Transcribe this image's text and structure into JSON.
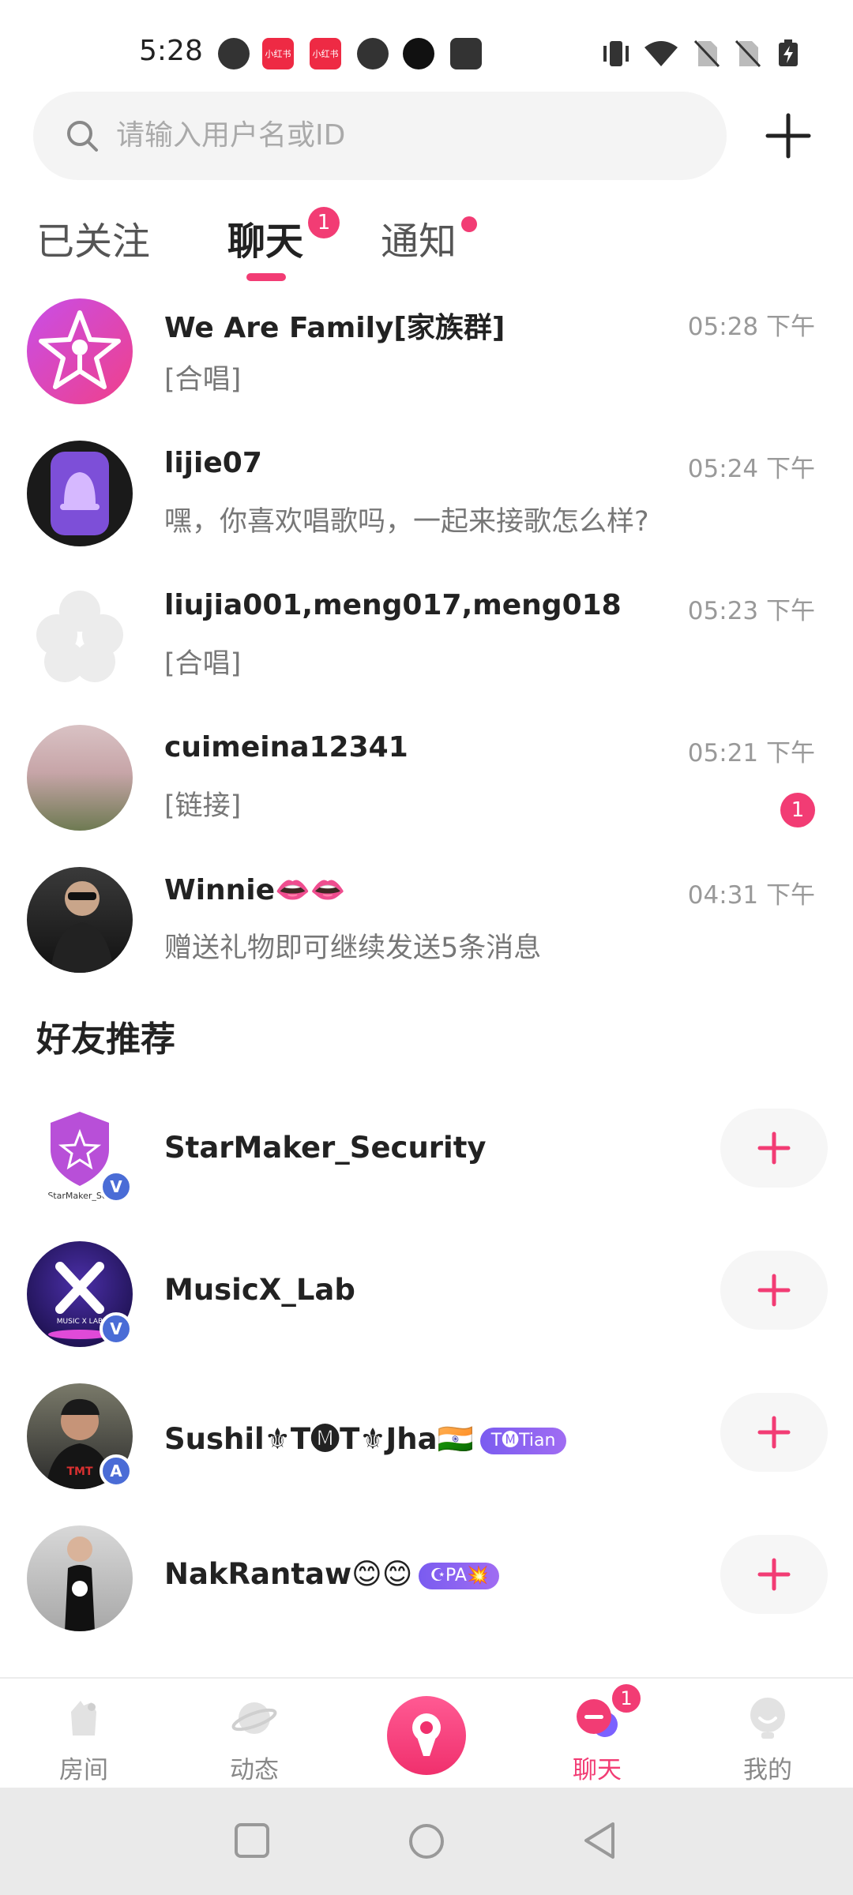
{
  "status_bar": {
    "time": "5:28",
    "left_icons": [
      "pinterest-icon",
      "xiaohongshu-icon",
      "xiaohongshu-icon",
      "facebook-icon",
      "tiktok-icon",
      "wallet-icon"
    ],
    "app_icon_text": "小红书",
    "right_icons": [
      "vibrate-icon",
      "wifi-icon",
      "no-sim-icon",
      "no-sim-icon",
      "battery-charging-icon"
    ]
  },
  "search": {
    "placeholder": "请输入用户名或ID"
  },
  "tabs": [
    {
      "label": "已关注"
    },
    {
      "label": "聊天",
      "badge": "1",
      "active": true
    },
    {
      "label": "通知",
      "dot": true
    }
  ],
  "chats": [
    {
      "name": "We Are Family[家族群]",
      "message": "[合唱]",
      "time": "05:28 下午"
    },
    {
      "name": "lijie07",
      "message": "嘿，你喜欢唱歌吗，一起来接歌怎么样?",
      "time": "05:24 下午"
    },
    {
      "name": "liujia001,meng017,meng018",
      "message": "[合唱]",
      "time": "05:23 下午"
    },
    {
      "name": "cuimeina12341",
      "message": "[链接]",
      "time": "05:21 下午",
      "unread": "1"
    },
    {
      "name": "Winnie👄👄",
      "message": "赠送礼物即可继续发送5条消息",
      "time": "04:31 下午"
    }
  ],
  "recommendations_title": "好友推荐",
  "recommendations": [
    {
      "name": "StarMaker_Security",
      "badge": "V",
      "avatar_text": "StarMaker_Sec"
    },
    {
      "name": "MusicX_Lab",
      "badge": "V",
      "avatar_text": "MUSIC X LAB"
    },
    {
      "name": "Sushil⚜T🅜T⚜Jha🇮🇳",
      "badge": "A",
      "tag": "T🅜Tian",
      "avatar_text": "TMT"
    },
    {
      "name": "NakRantaw😊😊",
      "tag": "☪PA💥"
    }
  ],
  "bottom_nav": [
    {
      "label": "房间"
    },
    {
      "label": "动态"
    },
    {
      "label": ""
    },
    {
      "label": "聊天",
      "badge": "1",
      "active": true
    },
    {
      "label": "我的"
    }
  ],
  "colors": {
    "accent": "#f23c74",
    "verify": "#4a6cd6",
    "tag": "#8a62f1"
  }
}
